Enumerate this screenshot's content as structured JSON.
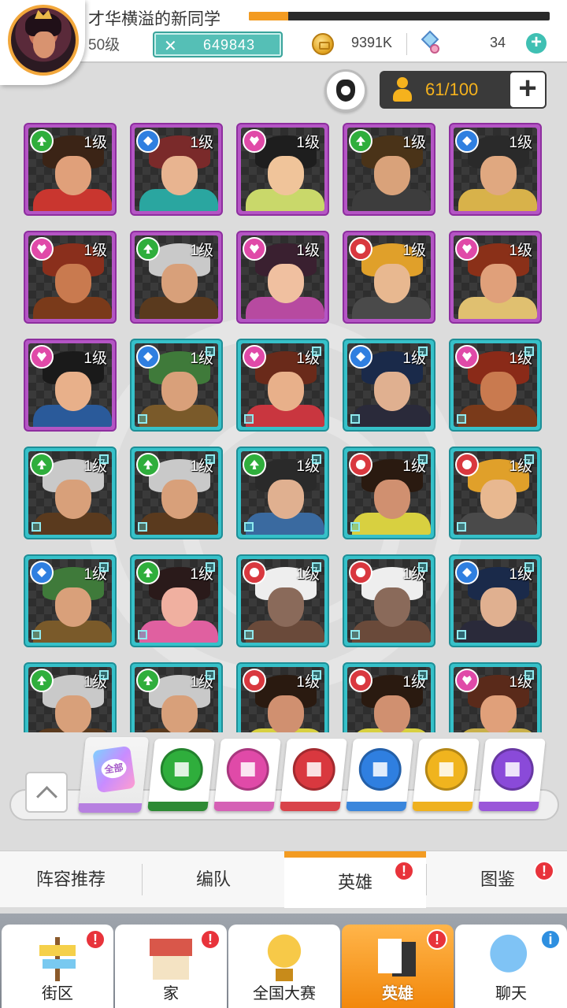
{
  "player": {
    "name": "才华横溢的新同学",
    "level": "50级",
    "xp_fraction": 0.13,
    "power": "649843",
    "coins": "9391K",
    "gems": "34"
  },
  "roster": {
    "capacity": "61/100"
  },
  "heroes": [
    {
      "level": "1级",
      "element": "green",
      "rarity": "epic",
      "hair": "#3b2416",
      "skin": "#e0a07a",
      "cloth": "#c9362f"
    },
    {
      "level": "1级",
      "element": "blue",
      "rarity": "epic",
      "hair": "#7a2a2a",
      "skin": "#e8b490",
      "cloth": "#2aa6a0"
    },
    {
      "level": "1级",
      "element": "pink",
      "rarity": "epic",
      "hair": "#1e1e1e",
      "skin": "#f0c49a",
      "cloth": "#c9d86a"
    },
    {
      "level": "1级",
      "element": "green",
      "rarity": "epic",
      "hair": "#4a3318",
      "skin": "#d9a27a",
      "cloth": "#3d3d3d"
    },
    {
      "level": "1级",
      "element": "blue",
      "rarity": "epic",
      "hair": "#2a2a2a",
      "skin": "#e0a880",
      "cloth": "#d8b24a"
    },
    {
      "level": "1级",
      "element": "pink",
      "rarity": "epic",
      "hair": "#8a2f1c",
      "skin": "#c97a4f",
      "cloth": "#7a3a1a"
    },
    {
      "level": "1级",
      "element": "green",
      "rarity": "epic",
      "hair": "#c9c9c9",
      "skin": "#d8a07a",
      "cloth": "#5a3a1e"
    },
    {
      "level": "1级",
      "element": "pink",
      "rarity": "epic",
      "hair": "#3a2030",
      "skin": "#f0c0a0",
      "cloth": "#b74aa0"
    },
    {
      "level": "1级",
      "element": "red",
      "rarity": "epic",
      "hair": "#e0a02a",
      "skin": "#e8b890",
      "cloth": "#4a4a4a"
    },
    {
      "level": "1级",
      "element": "pink",
      "rarity": "epic",
      "hair": "#8a3018",
      "skin": "#e0a07a",
      "cloth": "#e0c070"
    },
    {
      "level": "1级",
      "element": "pink",
      "rarity": "epic",
      "hair": "#1a1a1a",
      "skin": "#e8b08a",
      "cloth": "#2a5a9a"
    },
    {
      "level": "1级",
      "element": "blue",
      "rarity": "rare",
      "hair": "#3f7a3a",
      "skin": "#d9a07a",
      "cloth": "#7a5a2a"
    },
    {
      "level": "1级",
      "element": "pink",
      "rarity": "rare",
      "hair": "#6a2a1a",
      "skin": "#e8b08a",
      "cloth": "#c9363f"
    },
    {
      "level": "1级",
      "element": "blue",
      "rarity": "rare",
      "hair": "#1a2a4a",
      "skin": "#e0b090",
      "cloth": "#2a2a3a"
    },
    {
      "level": "1级",
      "element": "pink",
      "rarity": "rare",
      "hair": "#8a2a18",
      "skin": "#c97a4f",
      "cloth": "#7a3a1a"
    },
    {
      "level": "1级",
      "element": "green",
      "rarity": "rare",
      "hair": "#c9c9c9",
      "skin": "#d8a07a",
      "cloth": "#5a3a1e"
    },
    {
      "level": "1级",
      "element": "green",
      "rarity": "rare",
      "hair": "#c9c9c9",
      "skin": "#d8a07a",
      "cloth": "#5a3a1e"
    },
    {
      "level": "1级",
      "element": "green",
      "rarity": "rare",
      "hair": "#2a2a2a",
      "skin": "#e0b090",
      "cloth": "#3a6aa0"
    },
    {
      "level": "1级",
      "element": "red",
      "rarity": "rare",
      "hair": "#2a1a10",
      "skin": "#d09070",
      "cloth": "#d8d040"
    },
    {
      "level": "1级",
      "element": "red",
      "rarity": "rare",
      "hair": "#e0a02a",
      "skin": "#e8b890",
      "cloth": "#4a4a4a"
    },
    {
      "level": "1级",
      "element": "blue",
      "rarity": "rare",
      "hair": "#3f7a3a",
      "skin": "#d9a07a",
      "cloth": "#7a5a2a"
    },
    {
      "level": "1级",
      "element": "green",
      "rarity": "rare",
      "hair": "#2a1a1a",
      "skin": "#f0b0a0",
      "cloth": "#e060a0"
    },
    {
      "level": "1级",
      "element": "red",
      "rarity": "rare",
      "hair": "#eeeeee",
      "skin": "#8a6a5a",
      "cloth": "#6a4a3a"
    },
    {
      "level": "1级",
      "element": "red",
      "rarity": "rare",
      "hair": "#eeeeee",
      "skin": "#8a6a5a",
      "cloth": "#6a4a3a"
    },
    {
      "level": "1级",
      "element": "blue",
      "rarity": "rare",
      "hair": "#1a2a4a",
      "skin": "#e0b090",
      "cloth": "#2a2a3a"
    },
    {
      "level": "1级",
      "element": "green",
      "rarity": "rare",
      "hair": "#c9c9c9",
      "skin": "#d8a07a",
      "cloth": "#5a3a1e"
    },
    {
      "level": "1级",
      "element": "green",
      "rarity": "rare",
      "hair": "#c9c9c9",
      "skin": "#d8a07a",
      "cloth": "#5a3a1e"
    },
    {
      "level": "1级",
      "element": "red",
      "rarity": "rare",
      "hair": "#2a1a10",
      "skin": "#d09070",
      "cloth": "#d8d040"
    },
    {
      "level": "1级",
      "element": "red",
      "rarity": "rare",
      "hair": "#2a1a10",
      "skin": "#d09070",
      "cloth": "#d8d040"
    },
    {
      "level": "1级",
      "element": "pink",
      "rarity": "rare",
      "hair": "#5a2a1a",
      "skin": "#e0a07a",
      "cloth": "#c9b04a"
    }
  ],
  "filters": [
    {
      "key": "all",
      "label": "全部",
      "color": "#b780e0"
    },
    {
      "key": "green",
      "color": "#2fae3c",
      "strip": "#2d8a34"
    },
    {
      "key": "pink",
      "color": "#e04aa8",
      "strip": "#d561b5"
    },
    {
      "key": "red",
      "color": "#d9383f",
      "strip": "#d9434a"
    },
    {
      "key": "blue",
      "color": "#2f7fe0",
      "strip": "#3a86dc"
    },
    {
      "key": "gold",
      "color": "#f0b41e",
      "strip": "#efb11e"
    },
    {
      "key": "purple",
      "color": "#8a4ad9",
      "strip": "#9a56d9"
    }
  ],
  "subtabs": {
    "lineup": "阵容推荐",
    "formation": "编队",
    "heroes": "英雄",
    "codex": "图鉴"
  },
  "nav": {
    "street": "街区",
    "home": "家",
    "tournament": "全国大赛",
    "heroes": "英雄",
    "chat": "聊天"
  },
  "badges": {
    "alert": "!",
    "info": "i"
  },
  "colors": {
    "accent_orange": "#f39b21",
    "epic_frame": "#b455c4",
    "rare_frame": "#36c1c9",
    "power_teal": "#55bfb6"
  }
}
